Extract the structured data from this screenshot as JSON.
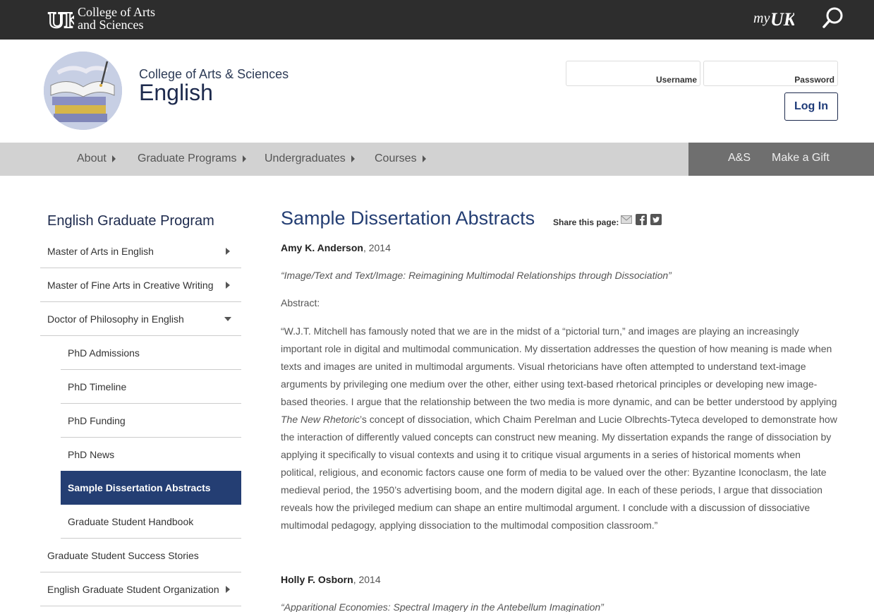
{
  "topbar": {
    "title_line1": "College of Arts",
    "title_line2": "and Sciences",
    "myuk_label": "my"
  },
  "header": {
    "college": "College of Arts & Sciences",
    "department": "English",
    "username_label": "Username",
    "password_label": "Password",
    "login_label": "Log In"
  },
  "nav": {
    "items": [
      "About",
      "Graduate Programs",
      "Undergraduates",
      "Courses"
    ],
    "right_items": [
      "A&S",
      "Make a Gift"
    ]
  },
  "sidebar": {
    "title": "English Graduate Program",
    "items": [
      "Master of Arts in English",
      "Master of Fine Arts in Creative Writing",
      "Doctor of Philosophy in English",
      "PhD Admissions",
      "PhD Timeline",
      "PhD Funding",
      "PhD News",
      "Sample Dissertation Abstracts",
      "Graduate Student Handbook",
      "Graduate Student Success Stories",
      "English Graduate Student Organization"
    ]
  },
  "main": {
    "title": "Sample Dissertation Abstracts",
    "share_label": "Share this page:",
    "entries": [
      {
        "author": "Amy K. Anderson",
        "year": ", 2014",
        "dissertation_title": "“Image/Text and Text/Image: Reimagining Multimodal Relationships through Dissociation”",
        "abstract_label": "Abstract:",
        "abstract_part1": "“W.J.T. Mitchell has famously noted that we are in the midst of a “pictorial turn,” and images are playing an increasingly important role in digital and multimodal communication. My dissertation addresses the question of how meaning is made when texts and images are united in multimodal arguments. Visual rhetoricians have often attempted to understand text-image arguments by privileging one medium over the other, either using text-based rhetorical principles or developing new image-based theories. I argue that the relationship between the two media is more dynamic, and can be better understood by applying ",
        "abstract_italic": "The New Rhetoric",
        "abstract_part2": "’s concept of dissociation, which Chaim Perelman and Lucie Olbrechts-Tyteca developed to demonstrate how the interaction of differently valued concepts can construct new meaning. My dissertation expands the range of dissociation by applying it specifically to visual contexts and using it to critique visual arguments in a series of historical moments when political, religious, and economic factors cause one form of media to be valued over the other: Byzantine Iconoclasm, the late medieval period, the 1950’s advertising boom, and the modern digital age. In each of these periods, I argue that dissociation reveals how the privileged medium can shape an entire multimodal argument. I conclude with a discussion of dissociative multimodal pedagogy, applying dissociation to the multimodal composition classroom.”"
      },
      {
        "author": "Holly F. Osborn",
        "year": ", 2014",
        "dissertation_title": "“Apparitional Economies: Spectral Imagery in the Antebellum Imagination”"
      }
    ]
  },
  "colors": {
    "topbar": "#2d2d2d",
    "brand_blue": "#243e73",
    "nav_gray": "#d2d2d2",
    "nav_right": "#6f6f6f"
  }
}
